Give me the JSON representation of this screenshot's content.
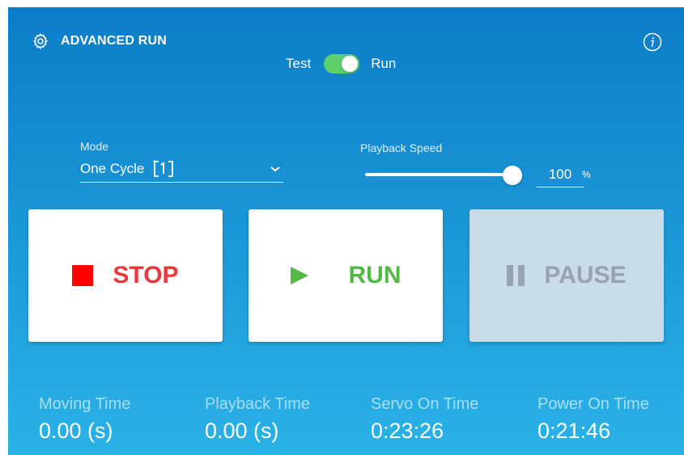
{
  "header": {
    "title": "ADVANCED RUN",
    "settings_icon": "gear-icon",
    "info_icon": "info-icon"
  },
  "mode_switch": {
    "left_label": "Test",
    "right_label": "Run",
    "state": "Run",
    "on_color": "#5cd06b"
  },
  "mode": {
    "label": "Mode",
    "value": "One Cycle",
    "icon": "one-cycle-icon"
  },
  "playback_speed": {
    "label": "Playback Speed",
    "value": "100",
    "unit": "%",
    "level": 1.0
  },
  "buttons": {
    "stop": {
      "label": "STOP",
      "icon": "stop-icon",
      "color": "#e8383d"
    },
    "run": {
      "label": "RUN",
      "icon": "play-icon",
      "color": "#52b947"
    },
    "pause": {
      "label": "PAUSE",
      "icon": "pause-icon",
      "color": "#97a4ad",
      "disabled": true
    }
  },
  "stats": [
    {
      "label": "Moving Time",
      "value": "0.00 (s)"
    },
    {
      "label": "Playback Time",
      "value": "0.00 (s)"
    },
    {
      "label": "Servo On Time",
      "value": "0:23:26"
    },
    {
      "label": "Power On Time",
      "value": "0:21:46"
    }
  ]
}
